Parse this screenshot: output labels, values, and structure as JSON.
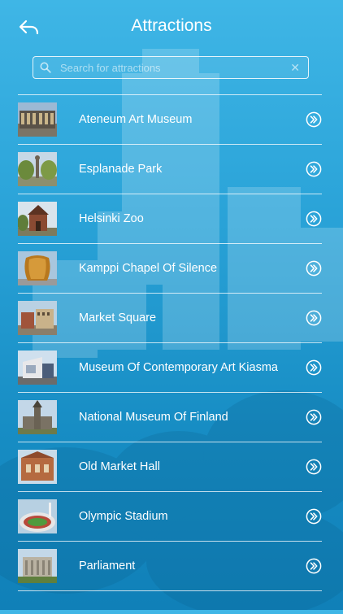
{
  "header": {
    "title": "Attractions",
    "back_icon": "back-arrow-icon"
  },
  "search": {
    "placeholder": "Search for attractions",
    "value": ""
  },
  "colors": {
    "background_top": "#3fb6e6",
    "background_bottom": "#1080b8",
    "text": "#ffffff"
  },
  "attractions": [
    {
      "label": "Ateneum Art Museum",
      "thumb": "museum-building"
    },
    {
      "label": "Esplanade Park",
      "thumb": "park-statue"
    },
    {
      "label": "Helsinki Zoo",
      "thumb": "zoo-tower"
    },
    {
      "label": "Kamppi Chapel Of Silence",
      "thumb": "wooden-chapel"
    },
    {
      "label": "Market Square",
      "thumb": "market-square"
    },
    {
      "label": "Museum Of Contemporary Art Kiasma",
      "thumb": "modern-building"
    },
    {
      "label": "National Museum Of Finland",
      "thumb": "stone-tower"
    },
    {
      "label": "Old Market Hall",
      "thumb": "brick-hall"
    },
    {
      "label": "Olympic Stadium",
      "thumb": "stadium"
    },
    {
      "label": "Parliament",
      "thumb": "parliament-building"
    }
  ]
}
